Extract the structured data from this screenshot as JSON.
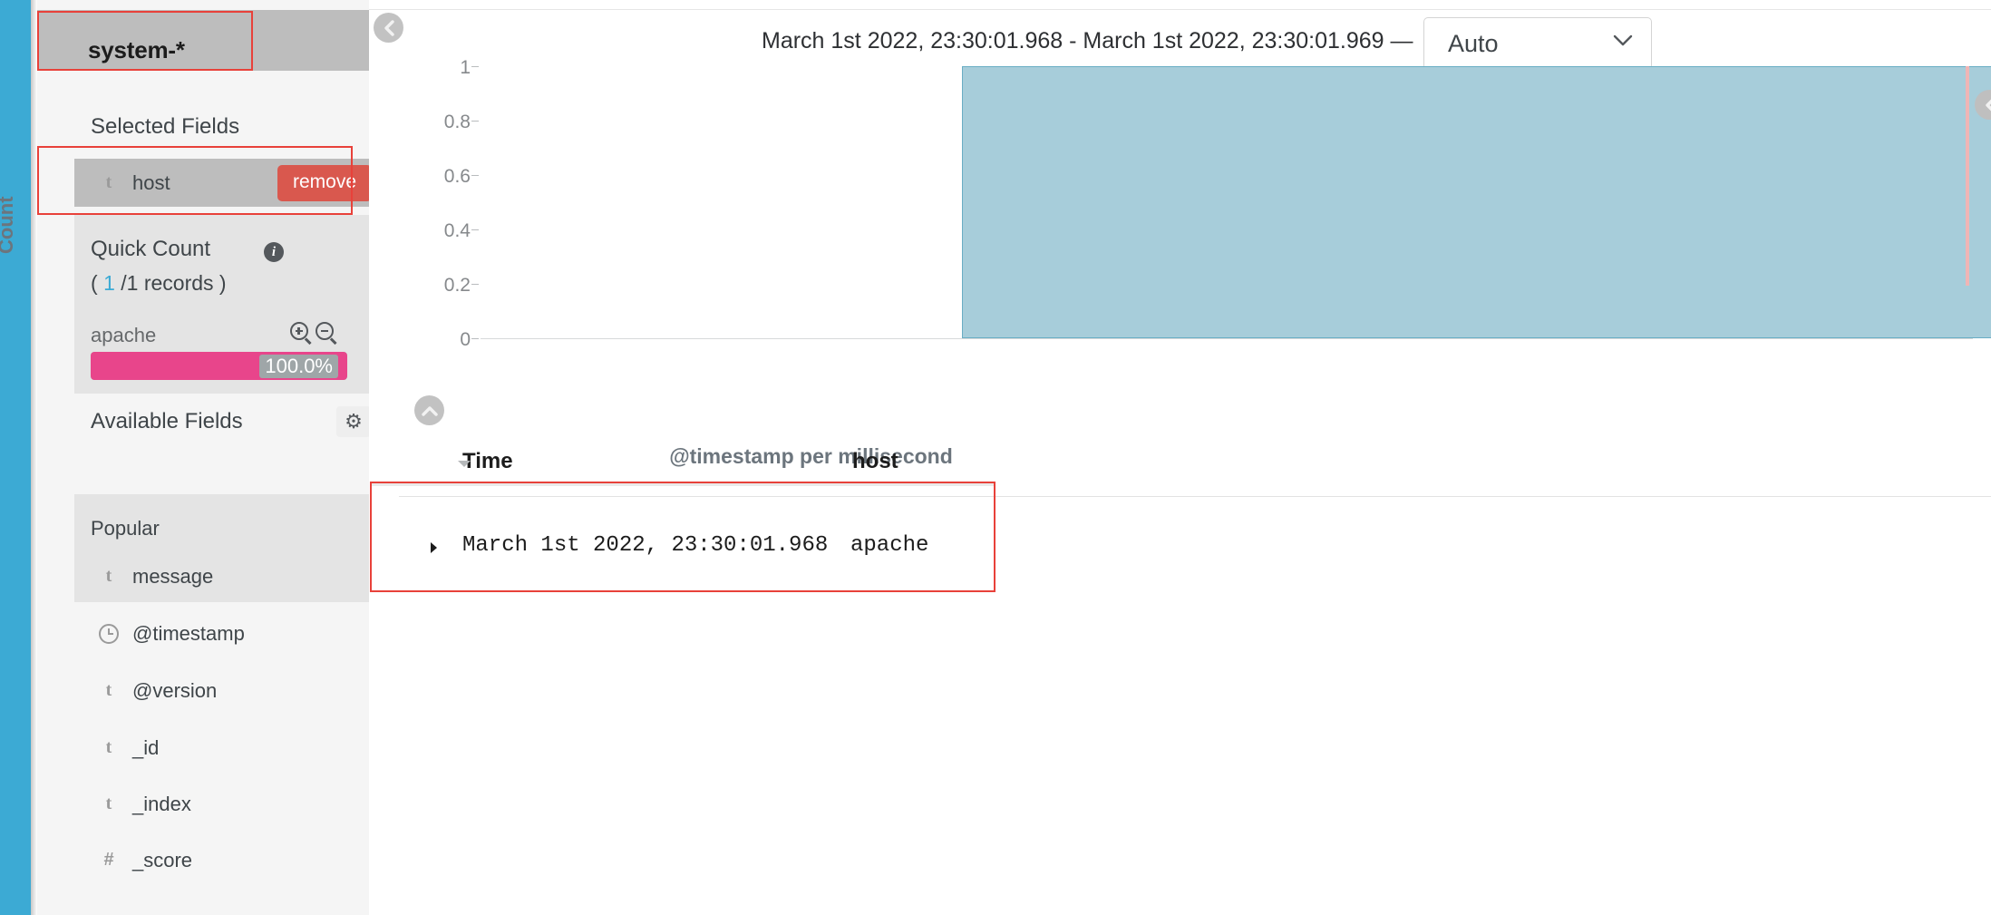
{
  "app": {
    "index_pattern": "system-*"
  },
  "sidebar": {
    "selected_fields_title": "Selected Fields",
    "selected_fields": [
      {
        "type_icon": "string-type-icon",
        "type_glyph": "t",
        "name": "host",
        "action_label": "remove"
      }
    ],
    "quick_count": {
      "title": "Quick Count",
      "info_icon": "info-icon",
      "records_prefix": "( ",
      "records_count": "1",
      "records_suffix": " /1 records )",
      "term_label": "apache",
      "percent_label": "100.0%",
      "percent_value": 100,
      "zoom_in_icon": "magnify-plus-icon",
      "zoom_out_icon": "magnify-minus-icon"
    },
    "available_fields_title": "Available Fields",
    "settings_icon": "gear-icon",
    "popular_label": "Popular",
    "popular_fields": [
      {
        "type_icon": "string-type-icon",
        "type_glyph": "t",
        "name": "message"
      }
    ],
    "available_fields": [
      {
        "type_icon": "clock-type-icon",
        "type_glyph": "",
        "name": "@timestamp"
      },
      {
        "type_icon": "string-type-icon",
        "type_glyph": "t",
        "name": "@version"
      },
      {
        "type_icon": "string-type-icon",
        "type_glyph": "t",
        "name": "_id"
      },
      {
        "type_icon": "string-type-icon",
        "type_glyph": "t",
        "name": "_index"
      },
      {
        "type_icon": "number-type-icon",
        "type_glyph": "#",
        "name": "_score"
      }
    ]
  },
  "header": {
    "collapse_sidebar_icon": "chevron-left-icon",
    "time_range": "March 1st 2022, 23:30:01.968 - March 1st 2022, 23:30:01.969 —",
    "interval": {
      "value": "Auto",
      "chevron_icon": "chevron-down-icon"
    }
  },
  "chart": {
    "collapse_icon": "chevron-up-icon",
    "right_edge_icon": "chevron-left-icon"
  },
  "chart_data": {
    "type": "bar",
    "title": "",
    "xlabel": "@timestamp per millisecond",
    "ylabel": "Count",
    "categories": [
      "March 1st 2022, 23:30:01.968"
    ],
    "values": [
      1
    ],
    "ylim": [
      0,
      1
    ],
    "yticks": [
      "0",
      "0.2",
      "0.4",
      "0.6",
      "0.8",
      "1"
    ],
    "ytick_values": [
      0,
      0.2,
      0.4,
      0.6,
      0.8,
      1
    ],
    "grid": false,
    "legend": "none",
    "bar_fill": "#a7cdda",
    "bar_stroke": "#69adc4",
    "time_marker_color": "#f0b5b5"
  },
  "doc_table": {
    "columns": [
      "Time",
      "host"
    ],
    "sort_icon": "sort-descending-caret-icon",
    "rows": [
      {
        "expand_icon": "expand-row-caret-icon",
        "time": "March 1st 2022, 23:30:01.968",
        "host": "apache"
      }
    ]
  },
  "colors": {
    "rail": "#3caad4",
    "accent_pink": "#e8458b",
    "remove_button": "#d9584e",
    "highlight_outline": "#e8413a"
  }
}
